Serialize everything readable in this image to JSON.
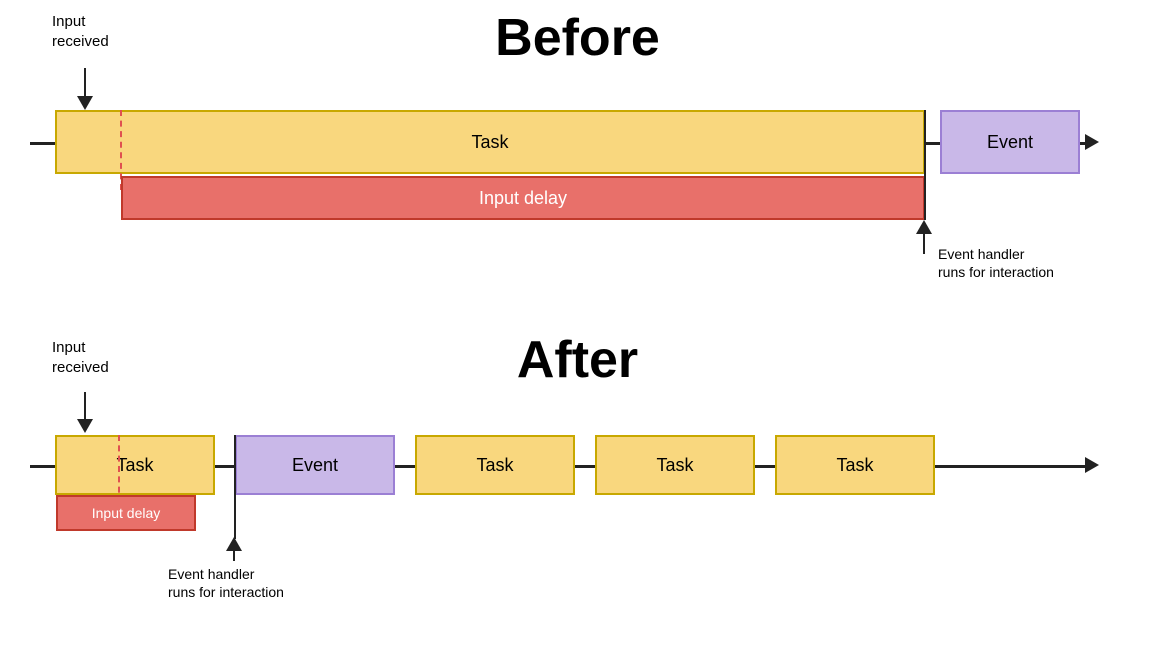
{
  "before": {
    "title": "Before",
    "input_received_label": "Input\nreceived",
    "task_label": "Task",
    "event_label": "Event",
    "input_delay_label": "Input delay",
    "event_handler_label": "Event handler\nruns for interaction"
  },
  "after": {
    "title": "After",
    "input_received_label": "Input\nreceived",
    "task_label": "Task",
    "event_label": "Event",
    "input_delay_label": "Input delay",
    "event_handler_label": "Event handler\nruns for interaction",
    "task2_label": "Task",
    "task3_label": "Task",
    "task4_label": "Task"
  }
}
